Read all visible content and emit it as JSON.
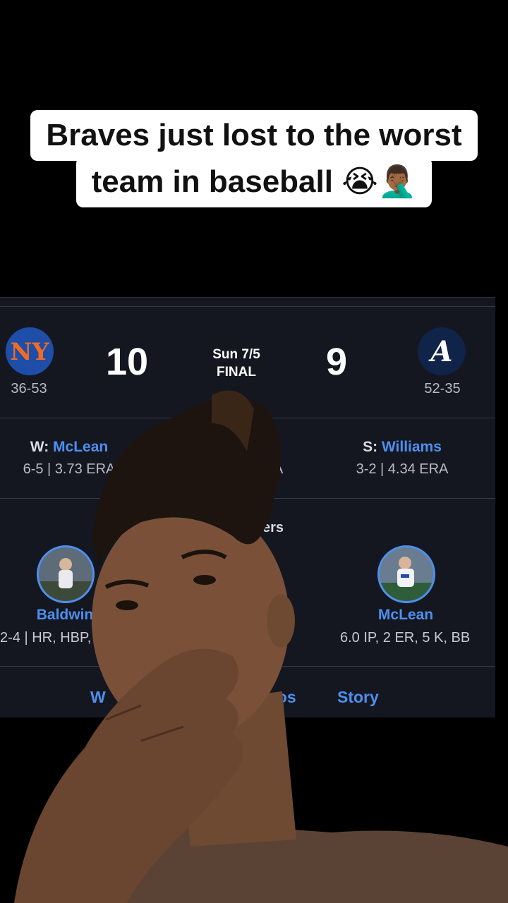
{
  "caption": {
    "line1": "Braves just lost to the worst",
    "line2": "team in baseball 😭🤦🏾‍♂️"
  },
  "game": {
    "away": {
      "abbr": "NY",
      "record": "36-53",
      "score": "10"
    },
    "home": {
      "abbr": "A",
      "record": "52-35",
      "score": "9"
    },
    "date": "Sun 7/5",
    "status": "FINAL",
    "winner": {
      "prefix": "W:",
      "name": "McLean",
      "stats": "6-5 | 3.73 ERA"
    },
    "save": {
      "prefix": "S:",
      "name": "Williams",
      "stats": "3-2 | 4.34 ERA"
    },
    "loser_fragment": "A",
    "section_fragment": "ers",
    "performers": [
      {
        "name": "Baldwin",
        "line": "2-4 | HR, HBP, 4"
      },
      {
        "name": "McLean",
        "line": "6.0 IP, 2 ER, 5 K, BB"
      }
    ],
    "links": {
      "watch_fragment": "W",
      "videos_fragment": "eos",
      "story": "Story"
    }
  },
  "colors": {
    "accent": "#4d8fee",
    "card": "#141720",
    "mets": "#1e4ea8",
    "braves": "#102348"
  }
}
